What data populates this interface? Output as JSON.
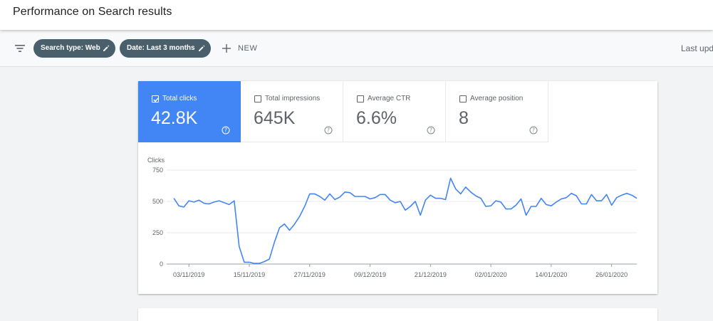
{
  "header": {
    "title": "Performance on Search results"
  },
  "filters": {
    "chips": [
      {
        "label": "Search type: Web"
      },
      {
        "label": "Date: Last 3 months"
      }
    ],
    "new_label": "NEW",
    "last_updated": "Last upd"
  },
  "metrics": [
    {
      "label": "Total clicks",
      "value": "42.8K",
      "checked": true
    },
    {
      "label": "Total impressions",
      "value": "645K",
      "checked": false
    },
    {
      "label": "Average CTR",
      "value": "6.6%",
      "checked": false
    },
    {
      "label": "Average position",
      "value": "8",
      "checked": false
    }
  ],
  "colors": {
    "accent": "#4285f4",
    "chip": "#4a5f6c",
    "line": "#4285f4"
  },
  "chart_data": {
    "type": "line",
    "ylabel": "Clicks",
    "yticks": [
      0,
      250,
      500,
      750
    ],
    "ylim": [
      0,
      750
    ],
    "xtick_labels": [
      "03/11/2019",
      "15/11/2019",
      "27/11/2019",
      "09/12/2019",
      "21/12/2019",
      "02/01/2020",
      "14/01/2020",
      "26/01/2020"
    ],
    "x_start": "2019-10-31",
    "series": [
      {
        "values": [
          525,
          465,
          455,
          505,
          495,
          510,
          485,
          480,
          495,
          505,
          490,
          475,
          505,
          140,
          15,
          15,
          5,
          5,
          20,
          40,
          175,
          290,
          320,
          270,
          320,
          380,
          460,
          560,
          560,
          540,
          510,
          560,
          515,
          535,
          575,
          570,
          540,
          540,
          540,
          520,
          530,
          555,
          555,
          510,
          490,
          500,
          430,
          460,
          500,
          390,
          510,
          550,
          525,
          525,
          515,
          685,
          600,
          560,
          615,
          575,
          545,
          525,
          460,
          465,
          505,
          495,
          440,
          440,
          470,
          520,
          390,
          460,
          460,
          525,
          475,
          465,
          495,
          520,
          530,
          565,
          545,
          480,
          480,
          555,
          505,
          505,
          555,
          470,
          530,
          550,
          565,
          550,
          525
        ]
      }
    ],
    "grid": true,
    "legend": "none"
  }
}
